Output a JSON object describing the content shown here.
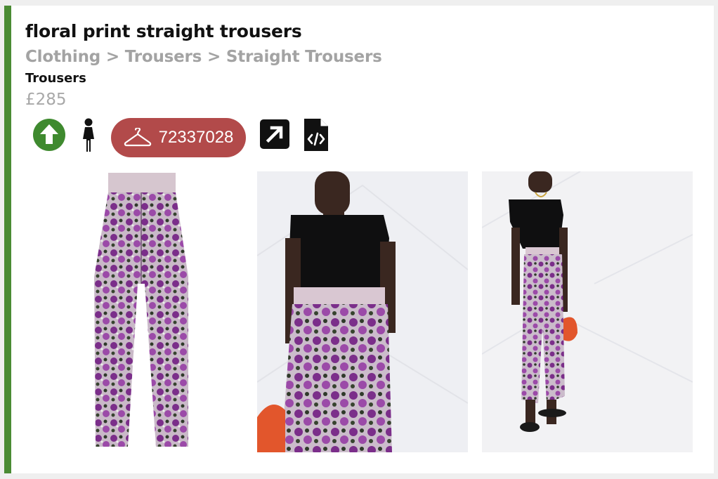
{
  "product": {
    "title": "floral print straight trousers",
    "breadcrumb": "Clothing > Trousers > Straight Trousers",
    "category": "Trousers",
    "price": "£285",
    "id_badge": "72337028"
  },
  "colors": {
    "accent_bar": "#4a8b34",
    "upvote": "#3f8a2f",
    "badge": "#b24a4a"
  },
  "icons": [
    "up-arrow-icon",
    "woman-icon",
    "hanger-icon",
    "external-link-icon",
    "code-file-icon"
  ]
}
